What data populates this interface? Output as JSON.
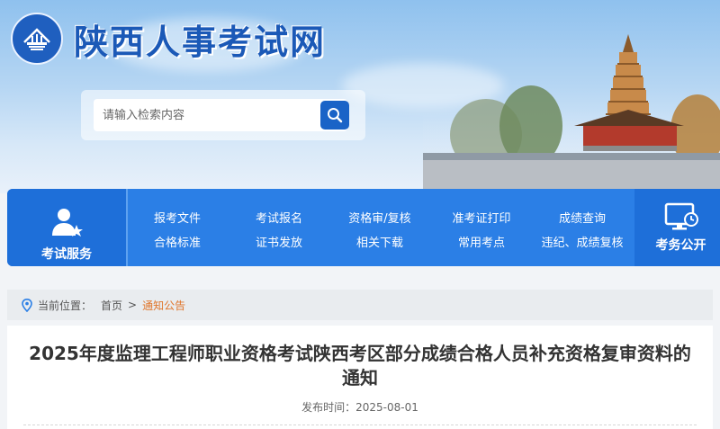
{
  "header": {
    "site_title": "陕西人事考试网",
    "search": {
      "placeholder": "请输入检索内容"
    }
  },
  "nav": {
    "left_label": "考试服务",
    "right_label": "考务公开",
    "links": [
      "报考文件",
      "考试报名",
      "资格审/复核",
      "准考证打印",
      "成绩查询",
      "合格标准",
      "证书发放",
      "相关下载",
      "常用考点",
      "违纪、成绩复核"
    ]
  },
  "breadcrumb": {
    "prefix": "当前位置：",
    "home": "首页",
    "separator": ">",
    "current": "通知公告"
  },
  "article": {
    "title": "2025年度监理工程师职业资格考试陕西考区部分成绩合格人员补充资格复审资料的通知",
    "publish_label": "发布时间：",
    "publish_date": "2025-08-01"
  },
  "colors": {
    "brand_blue": "#1b59b7",
    "nav_blue": "#2b7fe6",
    "breadcrumb_current": "#e0762c"
  }
}
